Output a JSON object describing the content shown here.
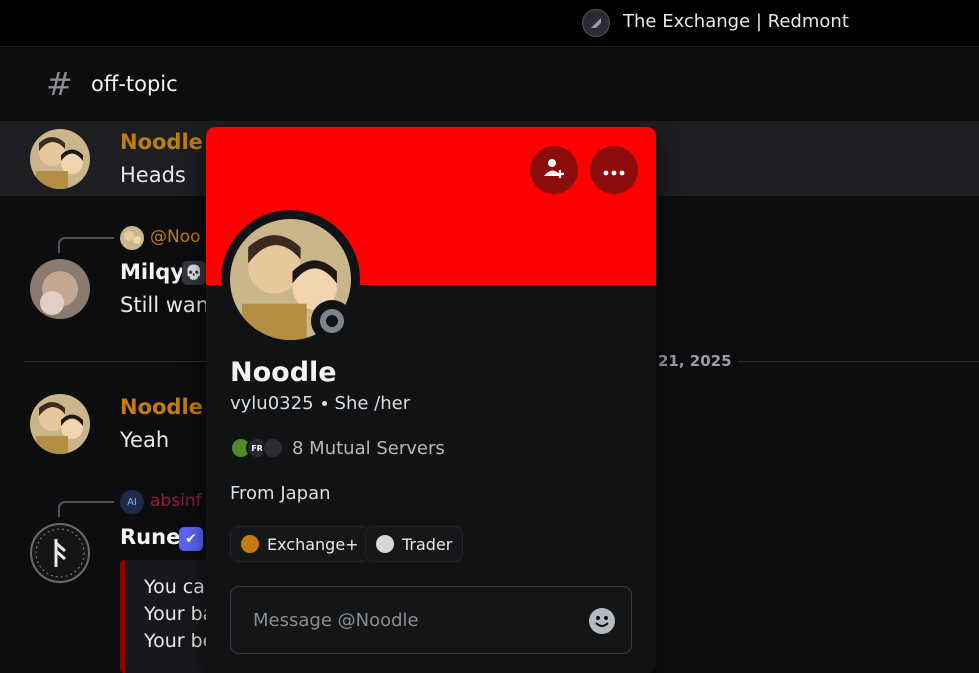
{
  "server": {
    "name": "The Exchange | Redmont",
    "icon": "server-icon"
  },
  "channel": {
    "hash": "#",
    "name": "off-topic"
  },
  "messages": {
    "m1": {
      "author": "Noodle",
      "author_color": "#c27c0e",
      "text": "Heads"
    },
    "m2": {
      "reply_to": "@Noo",
      "reply_color": "#c27c0e",
      "author": "Milqy",
      "badge": "💀",
      "text": "Still wan"
    },
    "divider_date": "21, 2025",
    "m3": {
      "author": "Noodle",
      "author_color": "#c27c0e",
      "text": "Yeah"
    },
    "m4": {
      "reply_to": "absinf",
      "reply_color": "#8e1f3a",
      "author": "Rune",
      "badge": "✔",
      "embed_lines": [
        "You car",
        "Your ba",
        "Your be"
      ]
    }
  },
  "profile": {
    "banner_color": "#ff0000",
    "display_name": "Noodle",
    "username": "vylu0325",
    "pronouns": "She /her",
    "mutual_servers": "8 Mutual Servers",
    "bio": "From Japan",
    "roles": [
      {
        "name": "Exchange+",
        "color": "#c27c0e"
      },
      {
        "name": "Trader",
        "color": "#d6d7da"
      }
    ],
    "message_placeholder": "Message @Noodle",
    "add_friend_icon": "add-friend-icon",
    "more_icon": "more-icon",
    "status": "offline"
  }
}
